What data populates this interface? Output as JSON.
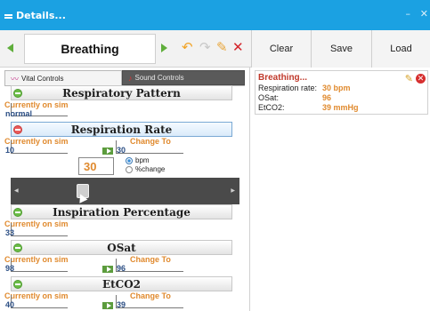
{
  "window": {
    "title": "Details...",
    "minimize_glyph": "–",
    "close_glyph": "✕"
  },
  "toolbar": {
    "scenario_name": "Breathing",
    "clear_label": "Clear",
    "save_label": "Save",
    "load_label": "Load",
    "icons": [
      "back-arrow-icon",
      "forward-arrow-icon",
      "undo-icon",
      "redo-icon",
      "clear-selection-icon",
      "delete-icon"
    ]
  },
  "tabs": {
    "vital_label": "Vital Controls",
    "sound_label": "Sound Controls"
  },
  "sections": {
    "respiratory_pattern": {
      "title": "Respiratory Pattern",
      "current_label": "Currently on sim",
      "current_value": "normal"
    },
    "respiration_rate": {
      "title": "Respiration Rate",
      "current_label": "Currently on sim",
      "current_value": "10",
      "change_label": "Change To",
      "change_value": "30",
      "input_value": "30",
      "unit_bpm": "bpm",
      "unit_pct": "%change",
      "selected_unit": "bpm",
      "slider_level_percent": 28
    },
    "inspiration_percentage": {
      "title": "Inspiration Percentage",
      "current_label": "Currently on sim",
      "current_value": "33"
    },
    "osat": {
      "title": "OSat",
      "current_label": "Currently on sim",
      "current_value": "98",
      "change_label": "Change To",
      "change_value": "96"
    },
    "etco2": {
      "title": "EtCO2",
      "current_label": "Currently on sim",
      "current_value": "40",
      "change_label": "Change To",
      "change_value": "39"
    }
  },
  "summary": {
    "title": "Breathing...",
    "rows": [
      {
        "label": "Respiration rate:",
        "value": "30 bpm"
      },
      {
        "label": "OSat:",
        "value": "96"
      },
      {
        "label": "EtCO2:",
        "value": "39 mmHg"
      }
    ]
  },
  "colors": {
    "titlebar": "#1ba1e2",
    "accent_orange": "#e08a2e",
    "value_blue": "#2c4f85",
    "add_green": "#6bbd46",
    "remove_red": "#ea5c5c"
  }
}
